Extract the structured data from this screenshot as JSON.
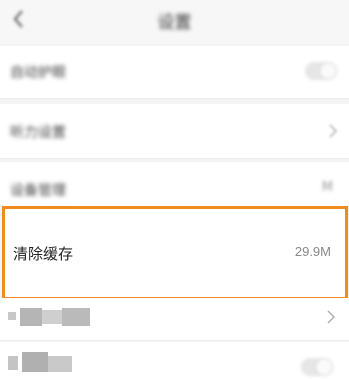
{
  "header": {
    "title": "设置",
    "back_icon": "chevron-left-icon"
  },
  "rows": [
    {
      "label": "自动护眼",
      "control": "toggle",
      "state": "off"
    },
    {
      "label": "听力设置",
      "control": "chevron"
    },
    {
      "label": "设备管理",
      "control": "chevron",
      "value": "M"
    },
    {
      "label": "清除缓存",
      "value": "29.9M",
      "highlighted": true
    },
    {
      "label": "检查版本",
      "control": "chevron"
    },
    {
      "label": "消息推送",
      "control": "toggle",
      "state": "off"
    }
  ],
  "colors": {
    "highlight_border": "#f28a1e",
    "background": "#f4f4f4",
    "row_background": "#ffffff"
  }
}
